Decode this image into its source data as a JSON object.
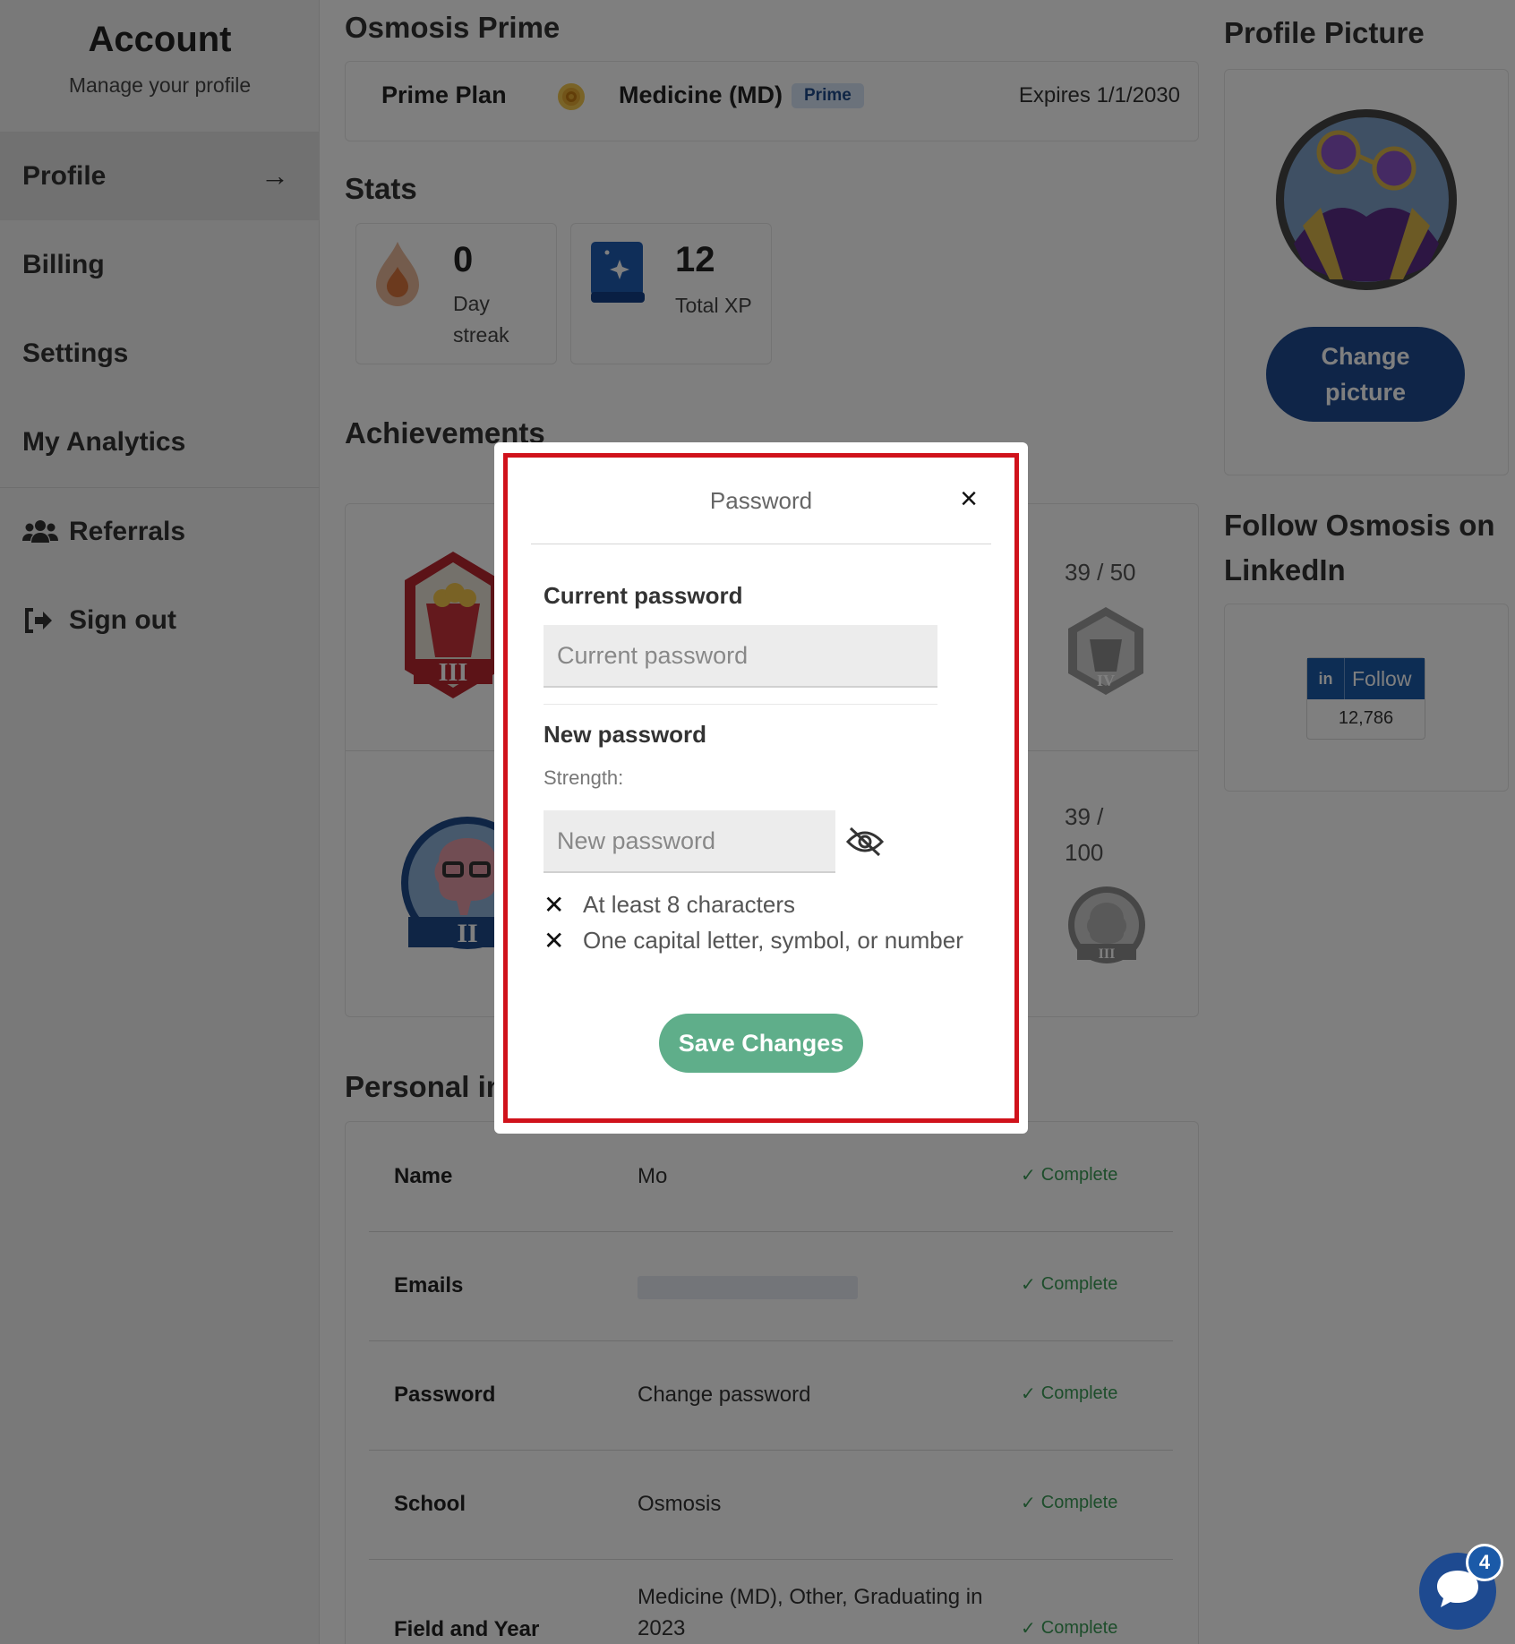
{
  "sidebar": {
    "title": "Account",
    "subtitle": "Manage your profile",
    "items": [
      {
        "label": "Profile"
      },
      {
        "label": "Billing"
      },
      {
        "label": "Settings"
      },
      {
        "label": "My Analytics"
      },
      {
        "label": "Referrals",
        "icon": "users-icon"
      },
      {
        "label": "Sign out",
        "icon": "sign-out-icon"
      }
    ]
  },
  "plan": {
    "section_title": "Osmosis Prime",
    "name": "Prime Plan",
    "program": "Medicine (MD)",
    "tag": "Prime",
    "expires": "Expires 1/1/2030"
  },
  "stats": {
    "title": "Stats",
    "streak_value": "0",
    "streak_label": "Day streak",
    "xp_value": "12",
    "xp_label": "Total XP"
  },
  "achievements": {
    "title": "Achievements",
    "items": [
      {
        "progress": "39 / 50",
        "current_level": "III",
        "next_level": "IV"
      },
      {
        "progress": "39 / 100",
        "current_level": "II",
        "next_level": "III"
      }
    ]
  },
  "personal": {
    "title": "Personal in",
    "rows": [
      {
        "label": "Name",
        "value": "Mo",
        "status": "Complete"
      },
      {
        "label": "Emails",
        "value": "",
        "status": "Complete"
      },
      {
        "label": "Password",
        "value": "Change password",
        "status": "Complete"
      },
      {
        "label": "School",
        "value": "Osmosis",
        "status": "Complete"
      },
      {
        "label": "Field and Year",
        "value": "Medicine (MD), Other, Graduating in 2023",
        "status": "Complete"
      }
    ]
  },
  "profile_picture": {
    "title": "Profile Picture",
    "button": "Change picture"
  },
  "linkedin": {
    "title": "Follow Osmosis on LinkedIn",
    "in_label": "in",
    "follow_label": "Follow",
    "count": "12,786"
  },
  "modal": {
    "title": "Password",
    "current_label": "Current password",
    "current_placeholder": "Current password",
    "new_label": "New password",
    "strength_label": "Strength:",
    "new_placeholder": "New password",
    "rules": [
      "At least 8 characters",
      "One capital letter, symbol, or number"
    ],
    "save": "Save Changes"
  },
  "chat": {
    "badge": "4"
  },
  "colors": {
    "brand_blue": "#1e4a90",
    "save_green": "#5fae8a",
    "complete_green": "#3a9b56",
    "highlight_red": "#d0121b"
  }
}
